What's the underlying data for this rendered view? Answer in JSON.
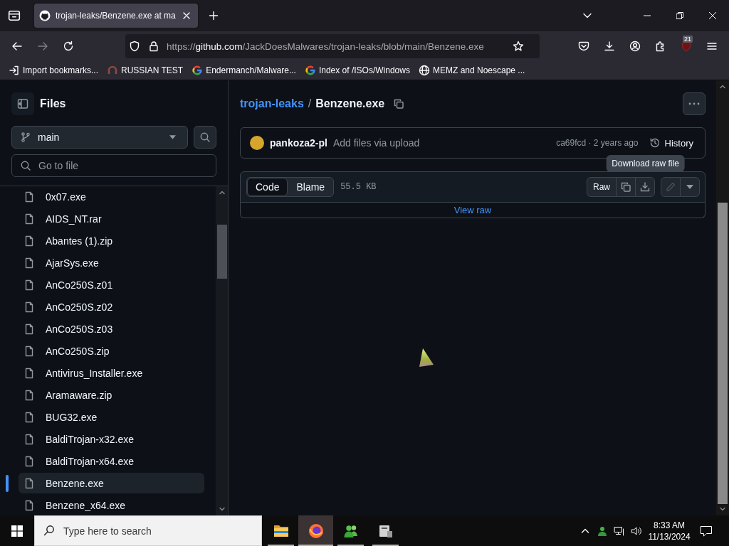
{
  "browser": {
    "tabs": [
      {
        "title": "trojan-leaks/Benzene.exe at ma",
        "selected": true
      }
    ],
    "navigation": {
      "forward_disabled": true
    },
    "address_bar": {
      "scheme": "https://",
      "host": "github.com",
      "path": "/JackDoesMalwares/trojan-leaks/blob/main/Benzene.exe"
    },
    "extension_badge": "21",
    "bookmarks": [
      {
        "kind": "import",
        "label": "Import bookmarks..."
      },
      {
        "kind": "site",
        "label": "RUSSIAN TEST"
      },
      {
        "kind": "google",
        "label": "Endermanch/Malware..."
      },
      {
        "kind": "google",
        "label": "Index of /ISOs/Windows"
      },
      {
        "kind": "globe",
        "label": "MEMZ and Noescape ..."
      }
    ]
  },
  "sidebar": {
    "title": "Files",
    "branch": "main",
    "file_search": {
      "placeholder": "Go to file"
    },
    "files": [
      {
        "name": "0x07.exe",
        "selected": false
      },
      {
        "name": "AIDS_NT.rar",
        "selected": false
      },
      {
        "name": "Abantes (1).zip",
        "selected": false
      },
      {
        "name": "AjarSys.exe",
        "selected": false
      },
      {
        "name": "AnCo250S.z01",
        "selected": false
      },
      {
        "name": "AnCo250S.z02",
        "selected": false
      },
      {
        "name": "AnCo250S.z03",
        "selected": false
      },
      {
        "name": "AnCo250S.zip",
        "selected": false
      },
      {
        "name": "Antivirus_Installer.exe",
        "selected": false
      },
      {
        "name": "Aramaware.zip",
        "selected": false
      },
      {
        "name": "BUG32.exe",
        "selected": false
      },
      {
        "name": "BaldiTrojan-x32.exe",
        "selected": false
      },
      {
        "name": "BaldiTrojan-x64.exe",
        "selected": false
      },
      {
        "name": "Benzene.exe",
        "selected": true
      },
      {
        "name": "Benzene_x64.exe",
        "selected": false
      }
    ]
  },
  "file_view": {
    "breadcrumb": {
      "repo": "trojan-leaks",
      "separator": "/",
      "file": "Benzene.exe"
    },
    "commit": {
      "author": "pankoza2-pl",
      "message": "Add files via upload",
      "info": "ca69fcd · 2 years ago",
      "history": "History"
    },
    "tooltip": "Download raw file",
    "view_tabs": [
      {
        "label": "Code",
        "selected": true
      },
      {
        "label": "Blame",
        "selected": false
      }
    ],
    "size": "55.5 KB",
    "raw": "Raw",
    "edit_disabled": true,
    "view_raw": "View raw"
  },
  "taskbar": {
    "search": {
      "placeholder": "Type here to search"
    },
    "apps": [
      {
        "kind": "explorer",
        "selected": false,
        "running": true
      },
      {
        "kind": "firefox",
        "selected": true,
        "running": true
      },
      {
        "kind": "people",
        "selected": false,
        "running": true
      },
      {
        "kind": "drive",
        "selected": false,
        "running": true
      }
    ],
    "time": "8:33 AM",
    "date": "11/13/2024"
  }
}
